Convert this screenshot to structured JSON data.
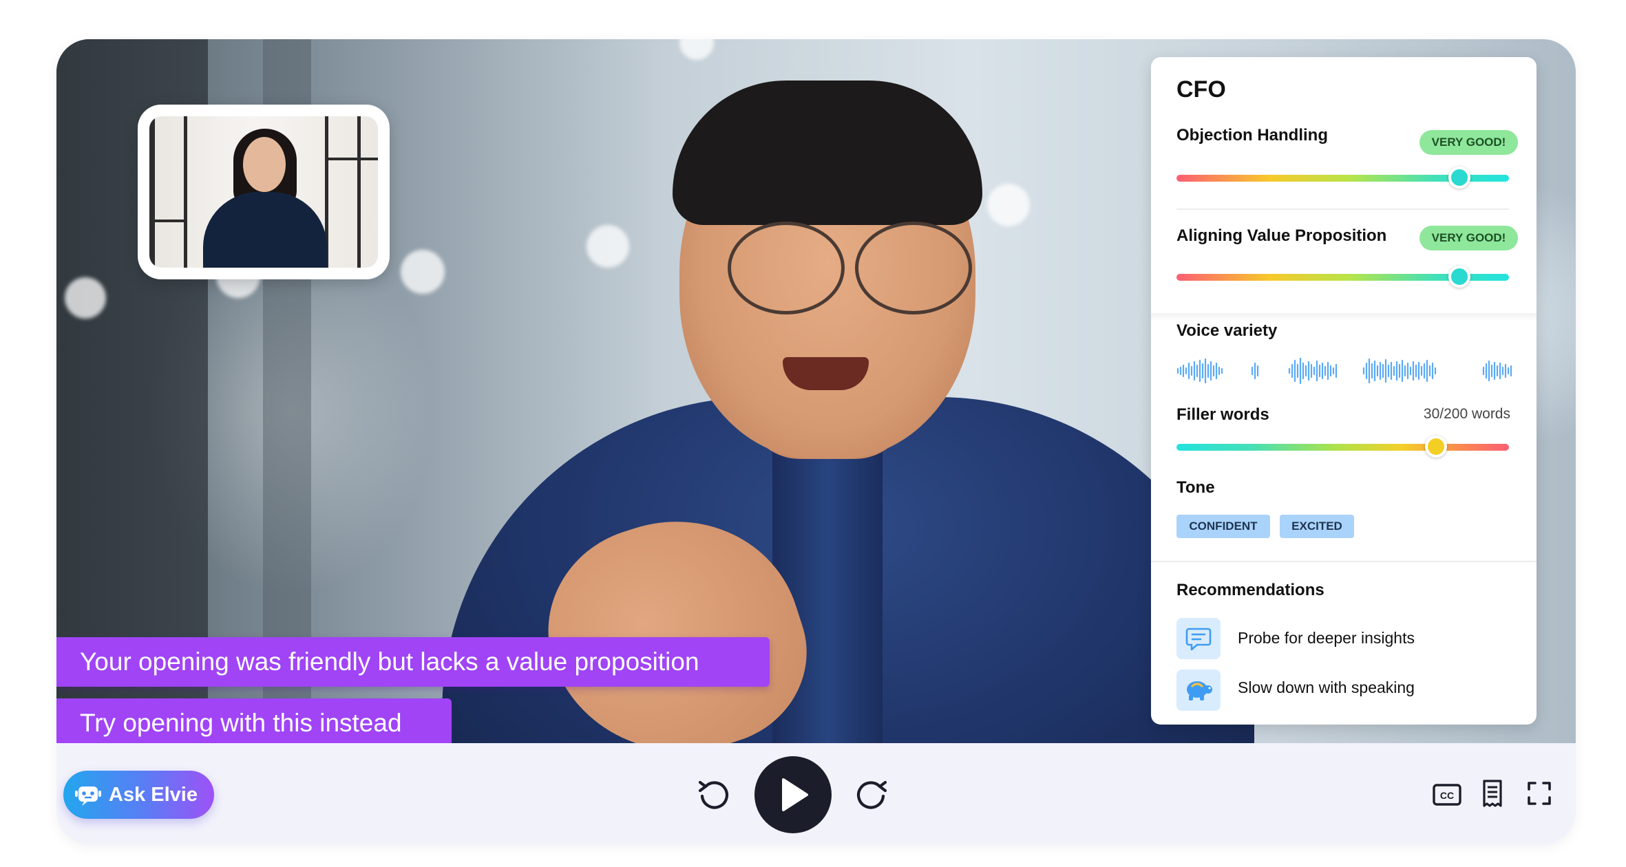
{
  "panel": {
    "title": "CFO",
    "metrics": [
      {
        "label": "Objection Handling",
        "badge": "VERY GOOD!",
        "level": 0.85
      },
      {
        "label": "Aligning Value Proposition",
        "badge": "VERY GOOD!",
        "level": 0.85
      }
    ],
    "voice_variety": {
      "label": "Voice variety"
    },
    "filler_words": {
      "label": "Filler words",
      "count": "30/200 words",
      "level": 0.78
    },
    "tone": {
      "label": "Tone",
      "chips": [
        "CONFIDENT",
        "EXCITED"
      ]
    },
    "recommendations": {
      "title": "Recommendations",
      "items": [
        {
          "label": "Probe for deeper insights",
          "icon": "chat-lines-icon"
        },
        {
          "label": "Slow down with speaking",
          "icon": "turtle-icon"
        }
      ]
    }
  },
  "captions": [
    "Your opening was friendly but lacks a value proposition",
    "Try opening with this instead"
  ],
  "controls": {
    "ask_label": "Ask Elvie",
    "icons": [
      "robot-icon",
      "rewind-icon",
      "play-icon",
      "forward-icon",
      "cc-icon",
      "transcript-icon",
      "fullscreen-icon"
    ]
  },
  "colors": {
    "caption_bg": "#a044f6",
    "badge_good": "#8ee79a",
    "tone_chip": "#a9d3fb",
    "play_button": "#1b1d2a",
    "controls_bg": "#f2f2fb"
  }
}
